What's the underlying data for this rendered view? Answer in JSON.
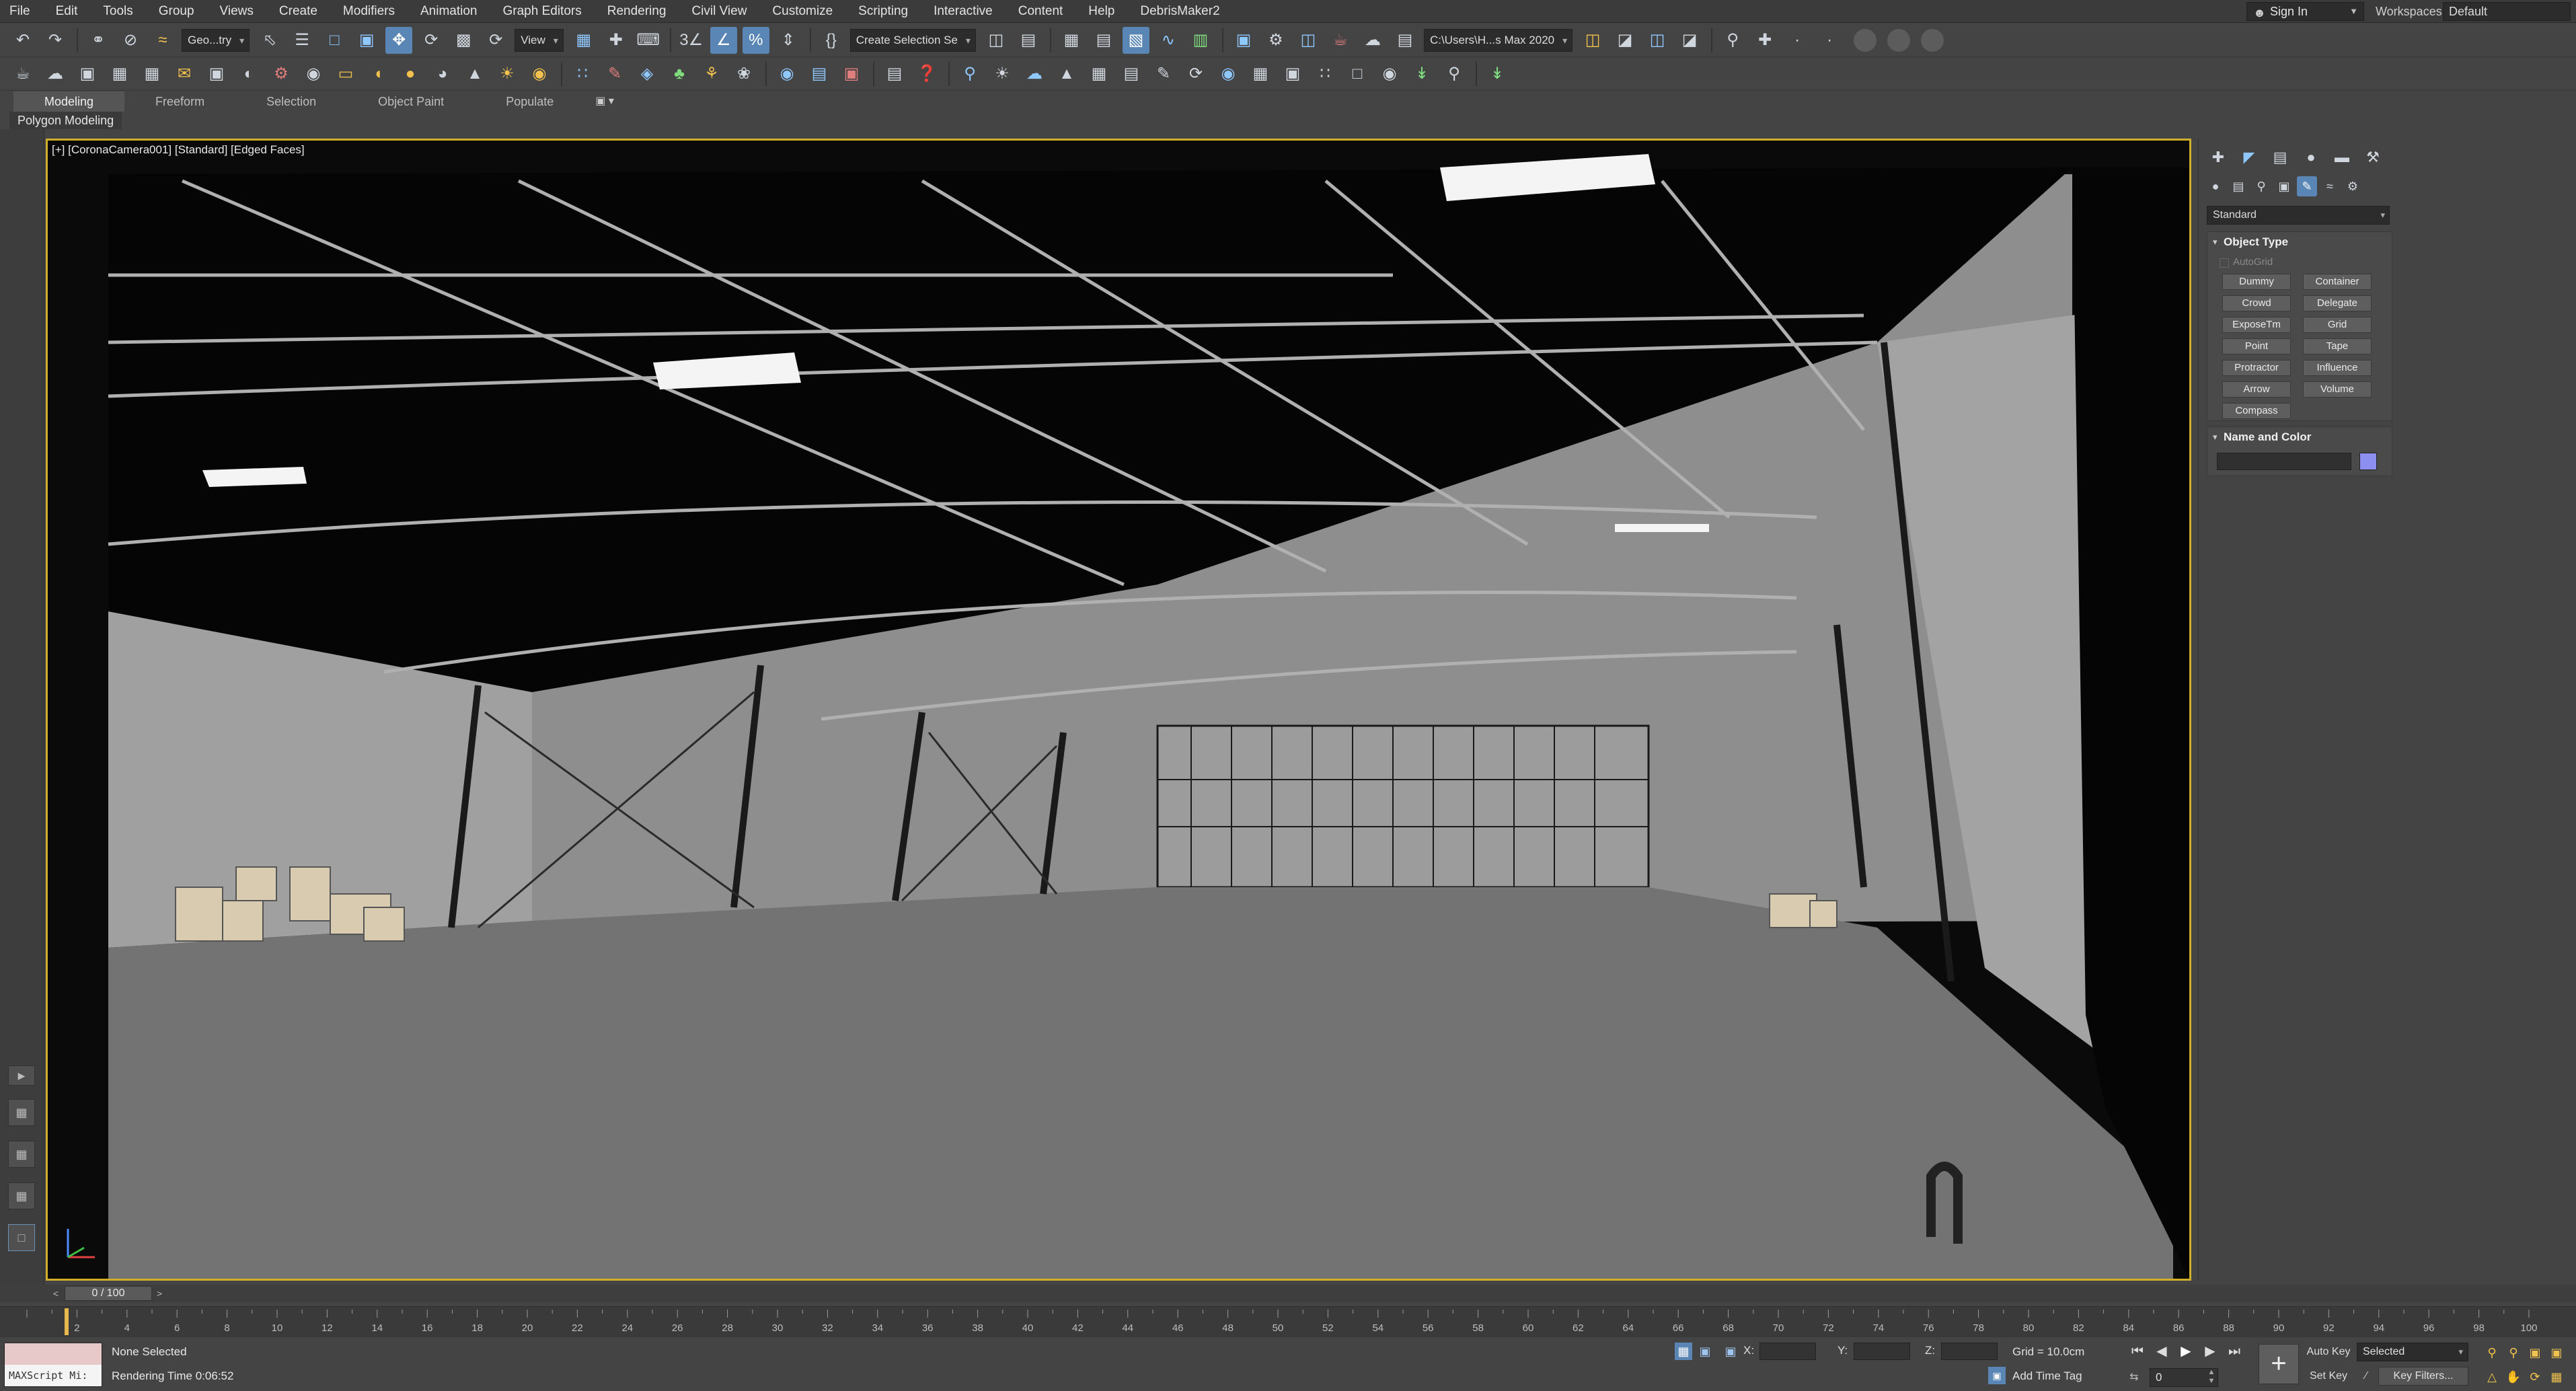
{
  "menubar": {
    "items": [
      "File",
      "Edit",
      "Tools",
      "Group",
      "Views",
      "Create",
      "Modifiers",
      "Animation",
      "Graph Editors",
      "Rendering",
      "Civil View",
      "Customize",
      "Scripting",
      "Interactive",
      "Content",
      "Help",
      "DebrisMaker2"
    ],
    "sign_in": "Sign In",
    "workspaces_label": "Workspaces:",
    "workspace_value": "Default"
  },
  "toolbar1": {
    "selection_filter": "Geo...try",
    "reference_coord": "View",
    "named_selection": "Create Selection Se",
    "project_path": "C:\\Users\\H...s Max 2020"
  },
  "ribbon": {
    "tabs": [
      "Modeling",
      "Freeform",
      "Selection",
      "Object Paint",
      "Populate"
    ],
    "extra": "▣ ▾",
    "subtitle": "Polygon Modeling"
  },
  "viewport": {
    "label": "[+] [CoronaCamera001] [Standard] [Edged Faces]"
  },
  "command_panel": {
    "category": "Standard",
    "object_type": {
      "title": "Object Type",
      "autogrid": "AutoGrid",
      "buttons": [
        "Dummy",
        "Container",
        "Crowd",
        "Delegate",
        "ExposeTm",
        "Grid",
        "Point",
        "Tape",
        "Protractor",
        "Influence",
        "Arrow",
        "Volume",
        "Compass"
      ]
    },
    "name_and_color": {
      "title": "Name and Color",
      "swatch_color": "#8d8ff0"
    }
  },
  "time_slider": {
    "frame_display": "0 / 100",
    "prev": "<",
    "next": ">"
  },
  "trackbar": {
    "start": 0,
    "end": 100,
    "label_step": 2,
    "current_frame": 0
  },
  "status": {
    "maxscript_label": "MAXScript Mi:",
    "selection_text": "None Selected",
    "rendering_time": "Rendering Time  0:06:52",
    "x_label": "X:",
    "y_label": "Y:",
    "z_label": "Z:",
    "grid_text": "Grid = 10.0cm",
    "add_time_tag": "Add Time Tag",
    "auto_key": "Auto Key",
    "set_key": "Set Key",
    "selected_value": "Selected",
    "key_filters": "Key Filters...",
    "current_frame": "0"
  },
  "colors": {
    "viewport_border": "#cfae2b",
    "active_tool": "#5a86b5",
    "frame_marker": "#e7b84b"
  }
}
